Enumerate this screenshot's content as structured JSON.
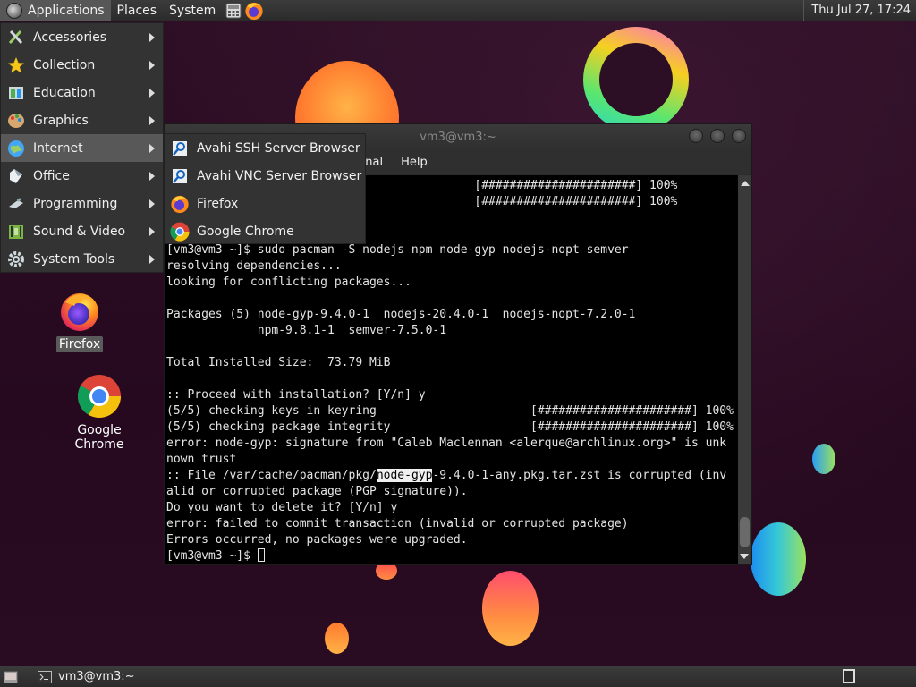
{
  "top_panel": {
    "menus": [
      "Applications",
      "Places",
      "System"
    ],
    "clock": "Thu Jul 27, 17:24"
  },
  "apps_menu": {
    "items": [
      {
        "label": "Accessories",
        "icon": "accessories-icon"
      },
      {
        "label": "Collection",
        "icon": "star-icon"
      },
      {
        "label": "Education",
        "icon": "education-icon"
      },
      {
        "label": "Graphics",
        "icon": "graphics-icon"
      },
      {
        "label": "Internet",
        "icon": "globe-icon"
      },
      {
        "label": "Office",
        "icon": "office-icon"
      },
      {
        "label": "Programming",
        "icon": "programming-icon"
      },
      {
        "label": "Sound & Video",
        "icon": "sound-video-icon"
      },
      {
        "label": "System Tools",
        "icon": "gear-icon"
      }
    ],
    "active": "Internet"
  },
  "internet_submenu": {
    "items": [
      {
        "label": "Avahi SSH Server Browser",
        "icon": "avahi-icon"
      },
      {
        "label": "Avahi VNC Server Browser",
        "icon": "avahi-icon"
      },
      {
        "label": "Firefox",
        "icon": "firefox-icon"
      },
      {
        "label": "Google Chrome",
        "icon": "chrome-icon"
      }
    ]
  },
  "desktop_icons": [
    {
      "label": "Firefox",
      "icon": "firefox-icon",
      "selected": true
    },
    {
      "label": "Google Chrome",
      "icon": "chrome-icon",
      "selected": false
    }
  ],
  "terminal": {
    "title": "vm3@vm3:~",
    "menus": [
      "minal",
      "Help"
    ],
    "lines_before_hl": "                                            [######################] 100%\n                                            [######################] 100%\n          hooks...\n          pdate...\n[vm3@vm3 ~]$ sudo pacman -S nodejs npm node-gyp nodejs-nopt semver\nresolving dependencies...\nlooking for conflicting packages...\n\nPackages (5) node-gyp-9.4.0-1  nodejs-20.4.0-1  nodejs-nopt-7.2.0-1\n             npm-9.8.1-1  semver-7.5.0-1\n\nTotal Installed Size:  73.79 MiB\n\n:: Proceed with installation? [Y/n] y\n(5/5) checking keys in keyring                      [######################] 100%\n(5/5) checking package integrity                    [######################] 100%\nerror: node-gyp: signature from \"Caleb Maclennan <alerque@archlinux.org>\" is unk\nnown trust\n:: File /var/cache/pacman/pkg/",
    "highlight": "node-gyp",
    "lines_after_hl": "-9.4.0-1-any.pkg.tar.zst is corrupted (inv\nalid or corrupted package (PGP signature)).\nDo you want to delete it? [Y/n] y\nerror: failed to commit transaction (invalid or corrupted package)\nErrors occurred, no packages were upgraded.\n[vm3@vm3 ~]$ "
  },
  "bottom_panel": {
    "task": "vm3@vm3:~"
  },
  "colors": {
    "panel": "#2f2f2f",
    "menu_bg": "#333333",
    "menu_active": "#585858",
    "terminal_bg": "#000000",
    "terminal_fg": "#e4e4e4"
  }
}
